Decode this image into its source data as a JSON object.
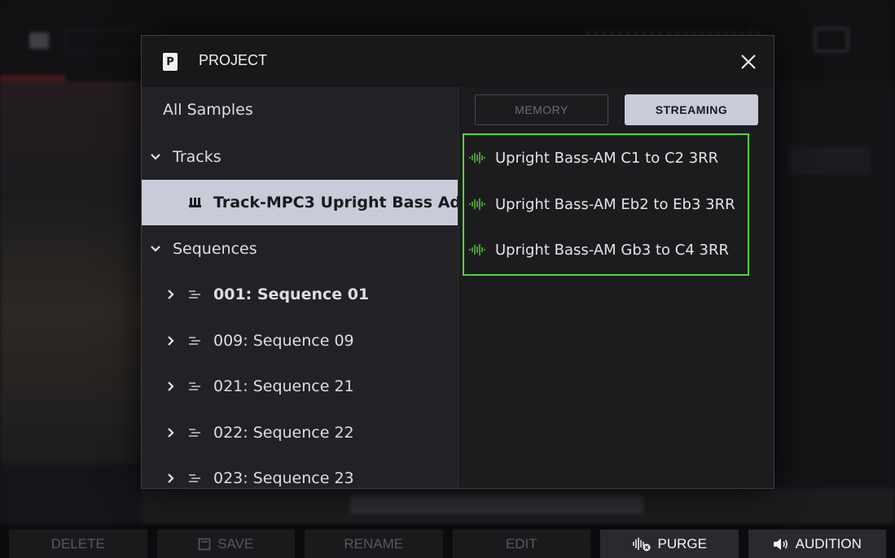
{
  "modal": {
    "title": "PROJECT",
    "project_icon_letter": "P",
    "close_icon": "close-icon"
  },
  "left_pane": {
    "all_samples": "All Samples",
    "tracks_label": "Tracks",
    "selected_track": "Track-MPC3 Upright Bass Ad",
    "sequences_label": "Sequences",
    "sequences": [
      {
        "label": "001: Sequence 01",
        "bold": true
      },
      {
        "label": "009: Sequence 09",
        "bold": false
      },
      {
        "label": "021: Sequence 21",
        "bold": false
      },
      {
        "label": "022: Sequence 22",
        "bold": false
      },
      {
        "label": "023: Sequence 23",
        "bold": false
      }
    ]
  },
  "right_pane": {
    "memory_label": "MEMORY",
    "streaming_label": "STREAMING",
    "active_mode": "STREAMING",
    "samples": [
      "Upright Bass-AM C1 to C2 3RR",
      "Upright Bass-AM Eb2 to Eb3 3RR",
      "Upright Bass-AM Gb3 to C4 3RR"
    ],
    "highlight_color": "#55d33a"
  },
  "softkeys": {
    "delete": "DELETE",
    "save": "SAVE",
    "rename": "RENAME",
    "edit": "EDIT",
    "purge": "PURGE",
    "audition": "AUDITION"
  },
  "colors": {
    "selected_bg": "#c9cbd8",
    "wave_green": "#55d33a",
    "modal_bg": "#222226"
  }
}
